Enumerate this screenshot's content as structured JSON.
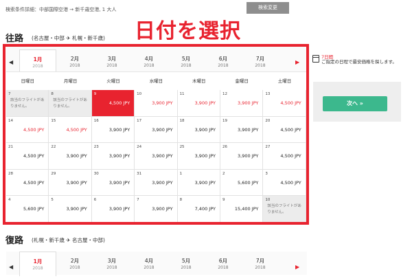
{
  "search": {
    "detail": "検索条件詳細：中部国際空港 → 新千歳空港, 1 大人",
    "change_button": "検索変更"
  },
  "headline": "日付を選択",
  "outbound": {
    "title": "往路",
    "route": "(名古屋・中部 ✈ 札幌・新千歳)"
  },
  "return": {
    "title": "復路",
    "route": "(札幌・新千歳 ✈ 名古屋・中部)"
  },
  "months": [
    {
      "label": "1月",
      "year": "2018",
      "active": true
    },
    {
      "label": "2月",
      "year": "2018"
    },
    {
      "label": "3月",
      "year": "2018"
    },
    {
      "label": "4月",
      "year": "2018"
    },
    {
      "label": "5月",
      "year": "2018"
    },
    {
      "label": "6月",
      "year": "2018"
    },
    {
      "label": "7月",
      "year": "2018"
    }
  ],
  "weekdays": [
    "日曜日",
    "月曜日",
    "火曜日",
    "水曜日",
    "木曜日",
    "金曜日",
    "土曜日"
  ],
  "calendar": [
    [
      {
        "day": "7",
        "na": "該当のフライトがありません。"
      },
      {
        "day": "8",
        "na": "該当のフライトがありません。"
      },
      {
        "day": "9",
        "price": "4,500 JPY",
        "selected": true
      },
      {
        "day": "10",
        "price": "3,900 JPY",
        "red": true
      },
      {
        "day": "11",
        "price": "3,900 JPY",
        "red": true
      },
      {
        "day": "12",
        "price": "3,900 JPY",
        "red": true
      },
      {
        "day": "13",
        "price": "4,500 JPY",
        "red": true
      }
    ],
    [
      {
        "day": "14",
        "price": "4,500 JPY",
        "red": true
      },
      {
        "day": "15",
        "price": "4,500 JPY",
        "red": true
      },
      {
        "day": "16",
        "price": "3,900 JPY"
      },
      {
        "day": "17",
        "price": "3,900 JPY"
      },
      {
        "day": "18",
        "price": "3,900 JPY"
      },
      {
        "day": "19",
        "price": "3,900 JPY"
      },
      {
        "day": "20",
        "price": "4,500 JPY"
      }
    ],
    [
      {
        "day": "21",
        "price": "4,500 JPY"
      },
      {
        "day": "22",
        "price": "3,900 JPY"
      },
      {
        "day": "23",
        "price": "3,900 JPY"
      },
      {
        "day": "24",
        "price": "3,900 JPY"
      },
      {
        "day": "25",
        "price": "3,900 JPY"
      },
      {
        "day": "26",
        "price": "3,900 JPY"
      },
      {
        "day": "27",
        "price": "4,500 JPY"
      }
    ],
    [
      {
        "day": "28",
        "price": "4,500 JPY"
      },
      {
        "day": "29",
        "price": "3,900 JPY"
      },
      {
        "day": "30",
        "price": "3,900 JPY"
      },
      {
        "day": "31",
        "price": "3,900 JPY"
      },
      {
        "day": "1",
        "price": "3,900 JPY"
      },
      {
        "day": "2",
        "price": "5,600 JPY"
      },
      {
        "day": "3",
        "price": "4,500 JPY"
      }
    ],
    [
      {
        "day": "4",
        "price": "5,600 JPY"
      },
      {
        "day": "5",
        "price": "3,900 JPY"
      },
      {
        "day": "6",
        "price": "3,900 JPY"
      },
      {
        "day": "7",
        "price": "3,900 JPY"
      },
      {
        "day": "8",
        "price": "7,400 JPY"
      },
      {
        "day": "9",
        "price": "15,400 JPY"
      },
      {
        "day": "10",
        "na": "該当のフライトがありません。"
      }
    ]
  ],
  "sidebar": {
    "title": "7日間",
    "description": "ご指定の日程で最安価格を探します。",
    "next_button": "次へ »"
  },
  "arrows": {
    "prev": "◀",
    "next": "▶"
  },
  "colors": {
    "accent_red": "#e8232f",
    "button_green": "#3cb88d"
  }
}
